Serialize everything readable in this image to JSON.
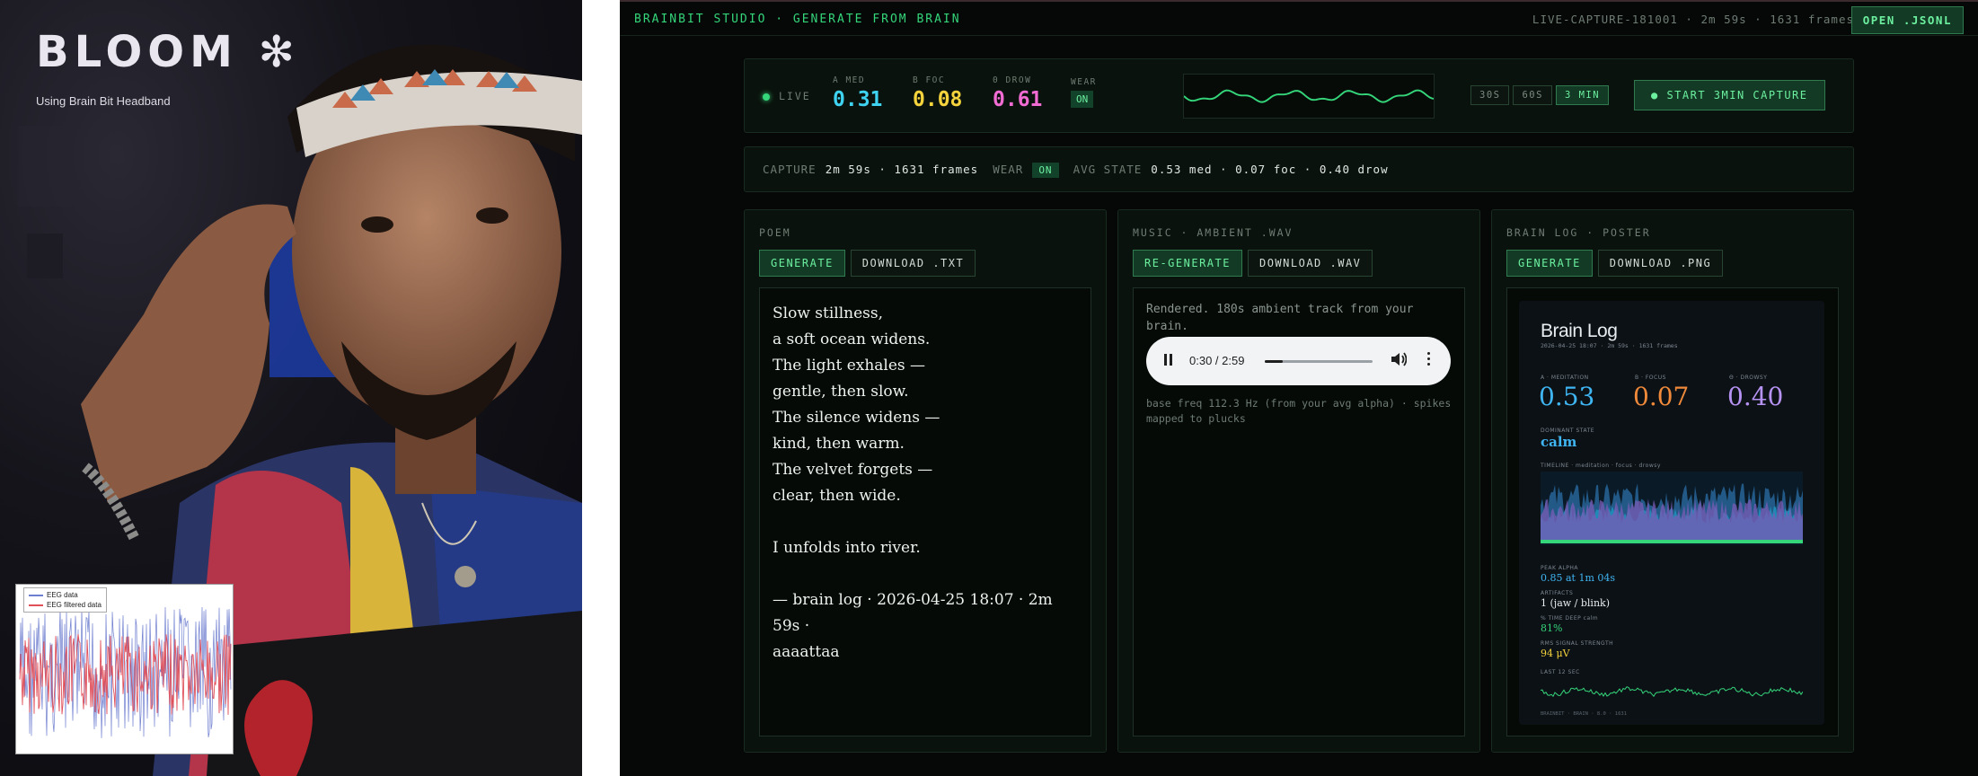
{
  "photo": {
    "logo": "BLOOM",
    "logo_icon": "asterisk-flower-icon",
    "subtitle": "Using Brain Bit Headband",
    "eeg_legend": [
      "EEG data",
      "EEG filtered data"
    ]
  },
  "topbar": {
    "brand": "BRAINBIT STUDIO · GENERATE FROM BRAIN",
    "session": "LIVE-CAPTURE-181001 · 2m 59s · 1631 frames",
    "open_button": "OPEN .JSONL"
  },
  "live": {
    "label": "LIVE",
    "metrics": [
      {
        "label": "A MED",
        "value": "0.31",
        "color": "#3fd3f2"
      },
      {
        "label": "B FOC",
        "value": "0.08",
        "color": "#f5d33c"
      },
      {
        "label": "0 DROW",
        "value": "0.61",
        "color": "#f06bd2"
      }
    ],
    "wear_label": "WEAR",
    "wear_value": "ON",
    "durations": [
      "30S",
      "60S",
      "3 MIN"
    ],
    "selected_duration": "3 MIN",
    "start_button": "● START 3MIN CAPTURE"
  },
  "stats": {
    "capture_label": "CAPTURE",
    "capture_value": "2m 59s · 1631 frames",
    "wear_label": "WEAR",
    "wear_value": "ON",
    "avg_label": "AVG STATE",
    "avg_value": "0.53 med · 0.07 foc · 0.40 drow"
  },
  "poem": {
    "title": "POEM",
    "generate": "GENERATE",
    "download": "DOWNLOAD .TXT",
    "text": "Slow stillness,\na soft ocean widens.\nThe light exhales —\ngentle, then slow.\nThe silence widens —\nkind, then warm.\nThe velvet forgets —\nclear, then wide.\n\nI unfolds into river.\n\n— brain log · 2026-04-25 18:07 · 2m 59s ·\n  aaaattaa"
  },
  "music": {
    "title": "MUSIC · AMBIENT .WAV",
    "regenerate": "RE-GENERATE",
    "download": "DOWNLOAD .WAV",
    "rendered": "Rendered. 180s ambient track from your brain.",
    "player_time": "0:30 / 2:59",
    "progress": 0.17,
    "base_freq": "base freq 112.3 Hz (from your avg alpha) · spikes mapped to plucks"
  },
  "brainlog": {
    "title": "BRAIN LOG · POSTER",
    "generate": "GENERATE",
    "download": "DOWNLOAD .PNG",
    "poster": {
      "heading": "Brain Log",
      "meta": "2026-04-25 18:07  ·  2m 59s  ·  1631 frames",
      "m1_label": "A · MEDITATION",
      "m1_value": "0.53",
      "m2_label": "B · FOCUS",
      "m2_value": "0.07",
      "m3_label": "Θ · DROWSY",
      "m3_value": "0.40",
      "dominant_label": "DOMINANT STATE",
      "dominant_value": "calm",
      "timeline_label": "TIMELINE · meditation · focus · drowsy",
      "peak_label": "PEAK ALPHA",
      "peak_value": "0.85 at 1m 04s",
      "artifacts_label": "ARTIFACTS",
      "artifacts_value": "1 (jaw / blink)",
      "iaf_label": "% TIME DEEP calm",
      "iaf_value": "81%",
      "rms_label": "RMS SIGNAL STRENGTH",
      "rms_value": "94 μV",
      "last_label": "LAST 12 SEC",
      "footer": "BRAINBIT · BRAIN · 8.0 · 1631"
    }
  }
}
